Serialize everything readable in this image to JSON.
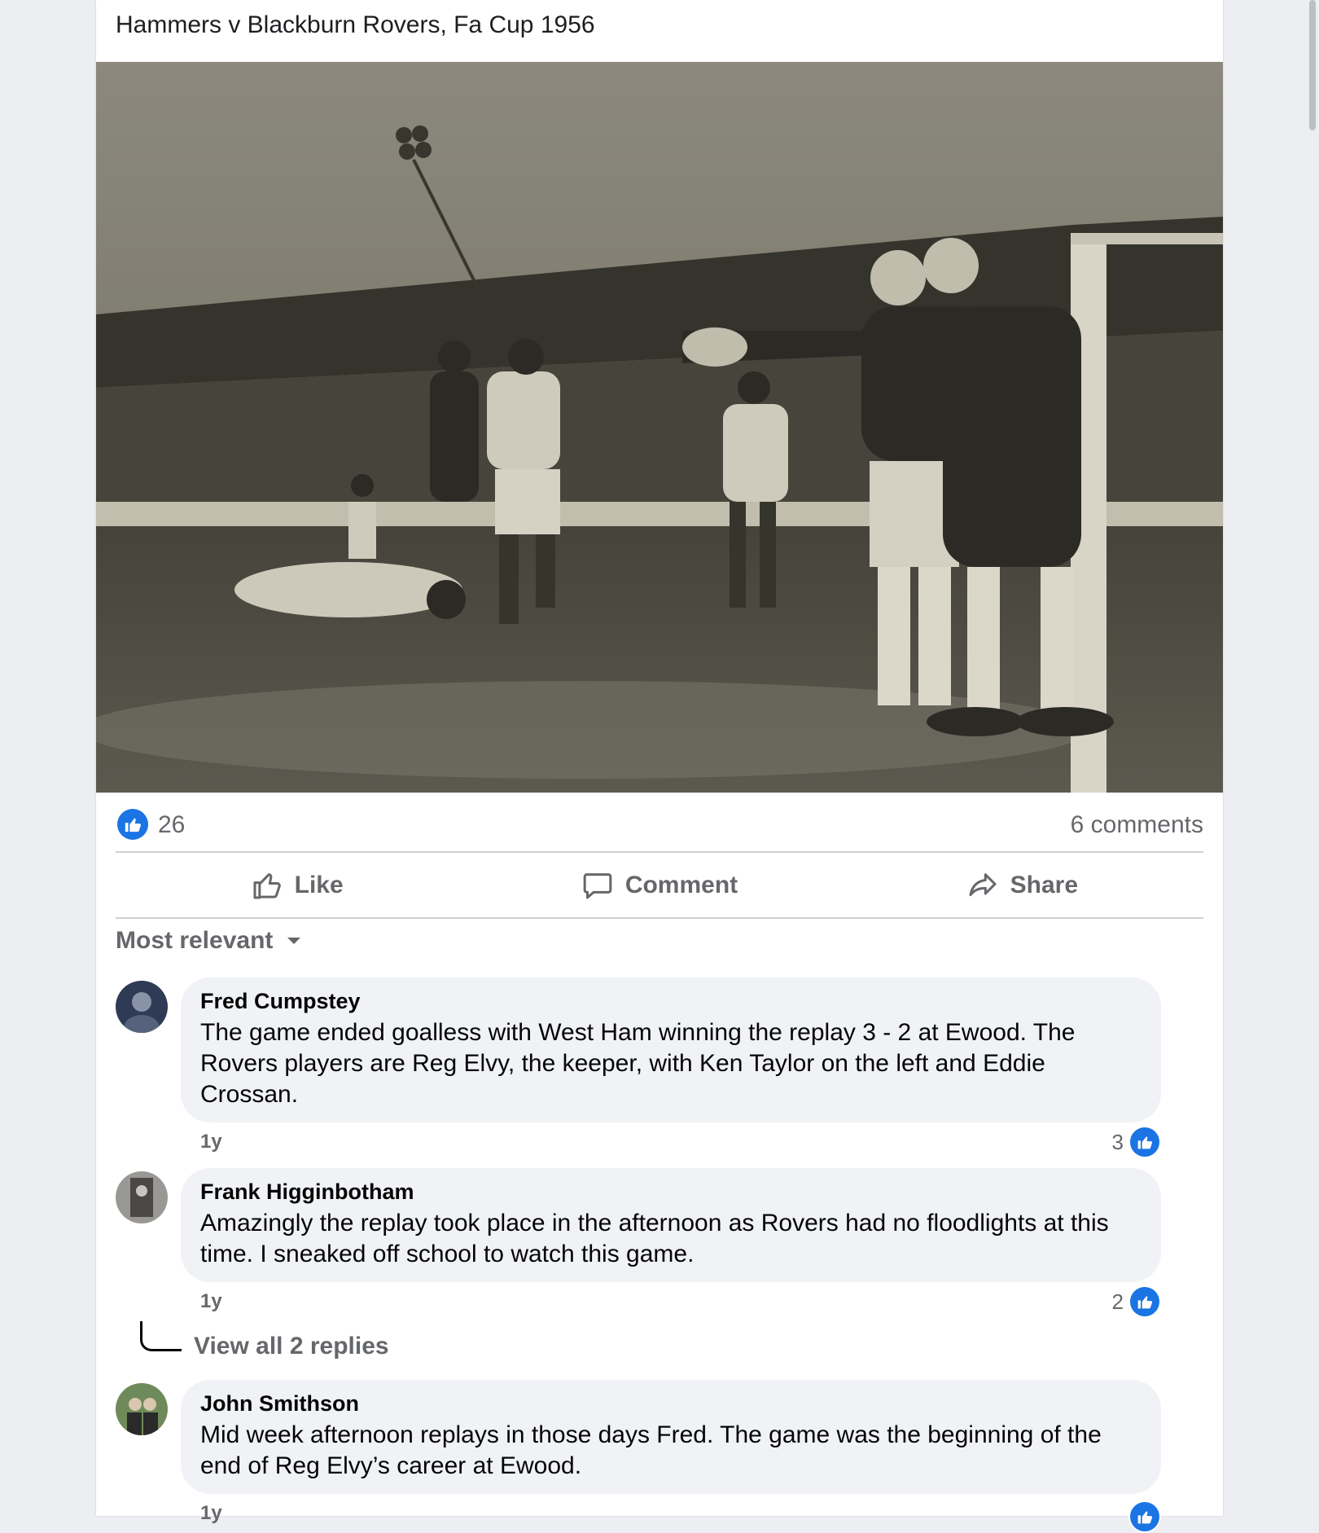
{
  "post": {
    "text": "Hammers v Blackburn Rovers,  Fa Cup 1956"
  },
  "photo": {
    "icon": "newspaper-photo"
  },
  "stats": {
    "likes": "26",
    "comments": "6 comments"
  },
  "actions": {
    "like": "Like",
    "comment": "Comment",
    "share": "Share"
  },
  "sort": {
    "label": "Most relevant"
  },
  "comments": [
    {
      "author": "Fred Cumpstey",
      "text": "The game ended goalless with West Ham winning the replay 3 - 2 at Ewood. The Rovers players are Reg Elvy, the keeper, with Ken Taylor on the left and Eddie Crossan.",
      "time": "1y",
      "reactions": "3"
    },
    {
      "author": "Frank Higginbotham",
      "text": "Amazingly the replay took place in the afternoon as Rovers had no floodlights at this time. I sneaked off school to watch this game.",
      "time": "1y",
      "reactions": "2"
    },
    {
      "author": "John Smithson",
      "text": "Mid week afternoon replays in those days Fred. The game was the beginning of the end of Reg Elvy’s career at Ewood.",
      "time": "1y",
      "reactions": ""
    }
  ],
  "replies": {
    "label": "View all 2 replies"
  },
  "colors": {
    "accent": "#1b74e4",
    "muted": "#65676b",
    "bubble": "#f0f2f5"
  }
}
